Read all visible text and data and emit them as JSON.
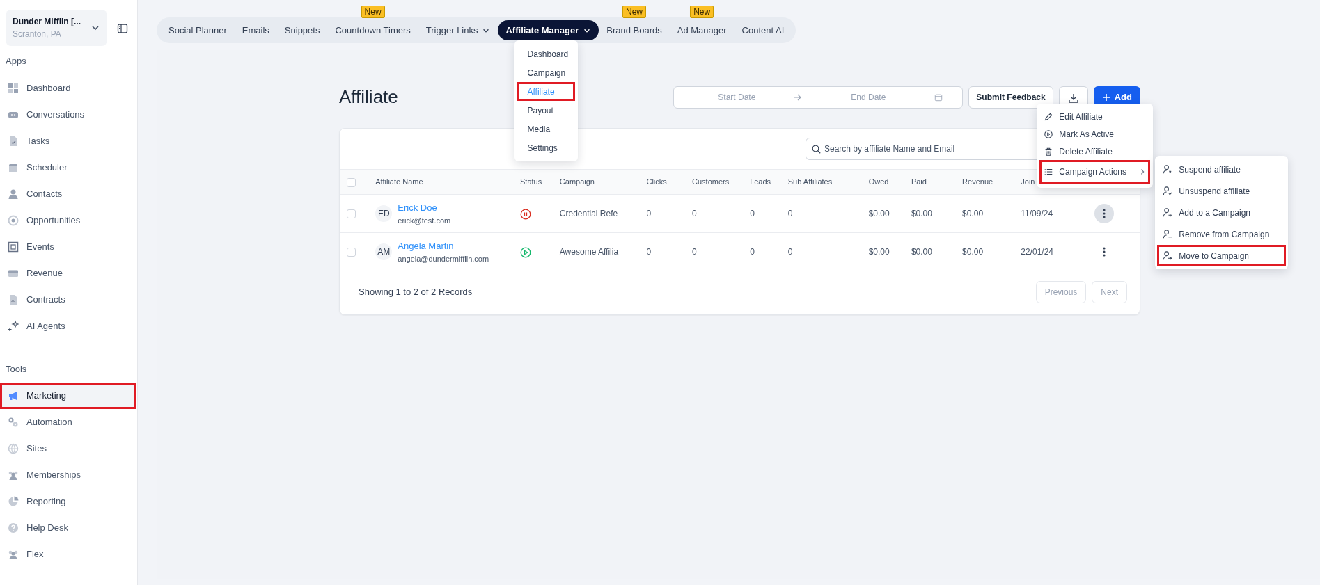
{
  "account": {
    "name": "Dunder Mifflin [...",
    "location": "Scranton, PA"
  },
  "sidebar": {
    "sections": [
      {
        "title": "Apps",
        "items": [
          {
            "label": "Dashboard",
            "selected": false,
            "highlighted": false
          },
          {
            "label": "Conversations",
            "selected": false,
            "highlighted": false
          },
          {
            "label": "Tasks",
            "selected": false,
            "highlighted": false
          },
          {
            "label": "Scheduler",
            "selected": false,
            "highlighted": false
          },
          {
            "label": "Contacts",
            "selected": false,
            "highlighted": false
          },
          {
            "label": "Opportunities",
            "selected": false,
            "highlighted": false
          },
          {
            "label": "Events",
            "selected": false,
            "highlighted": false
          },
          {
            "label": "Revenue",
            "selected": false,
            "highlighted": false
          },
          {
            "label": "Contracts",
            "selected": false,
            "highlighted": false
          },
          {
            "label": "AI Agents",
            "selected": false,
            "highlighted": false
          }
        ]
      },
      {
        "title": "Tools",
        "items": [
          {
            "label": "Marketing",
            "selected": true,
            "highlighted": true
          },
          {
            "label": "Automation",
            "selected": false,
            "highlighted": false
          },
          {
            "label": "Sites",
            "selected": false,
            "highlighted": false
          },
          {
            "label": "Memberships",
            "selected": false,
            "highlighted": false
          },
          {
            "label": "Reporting",
            "selected": false,
            "highlighted": false
          },
          {
            "label": "Help Desk",
            "selected": false,
            "highlighted": false
          },
          {
            "label": "Flex",
            "selected": false,
            "highlighted": false
          }
        ]
      }
    ]
  },
  "top_nav": [
    {
      "label": "Social Planner",
      "selected": false,
      "dropdown": false
    },
    {
      "label": "Emails",
      "selected": false,
      "dropdown": false
    },
    {
      "label": "Snippets",
      "selected": false,
      "dropdown": false
    },
    {
      "label": "Countdown Timers",
      "selected": false,
      "dropdown": false,
      "badge": "New"
    },
    {
      "label": "Trigger Links",
      "selected": false,
      "dropdown": true
    },
    {
      "label": "Affiliate Manager",
      "selected": true,
      "dropdown": true
    },
    {
      "label": "Brand Boards",
      "selected": false,
      "dropdown": false,
      "badge": "New"
    },
    {
      "label": "Ad Manager",
      "selected": false,
      "dropdown": false,
      "badge": "New"
    },
    {
      "label": "Content AI",
      "selected": false,
      "dropdown": false
    }
  ],
  "nav_dropdown": [
    {
      "label": "Dashboard",
      "selected": false,
      "highlighted": false
    },
    {
      "label": "Campaign",
      "selected": false,
      "highlighted": false
    },
    {
      "label": "Affiliate",
      "selected": true,
      "highlighted": true
    },
    {
      "label": "Payout",
      "selected": false,
      "highlighted": false
    },
    {
      "label": "Media",
      "selected": false,
      "highlighted": false
    },
    {
      "label": "Settings",
      "selected": false,
      "highlighted": false
    }
  ],
  "page": {
    "title": "Affiliate",
    "start_date": {
      "placeholder": "Start Date"
    },
    "end_date": {
      "placeholder": "End Date"
    },
    "feedback_button": "Submit Feedback",
    "add_button": "Add"
  },
  "table": {
    "search": {
      "placeholder": "Search by affiliate Name and Email"
    },
    "select_all_checked": false,
    "columns": [
      "Affiliate Name",
      "Status",
      "Campaign",
      "Clicks",
      "Customers",
      "Leads",
      "Sub Affiliates",
      "Owed",
      "Paid",
      "Revenue",
      "Join"
    ],
    "rows": [
      {
        "initials": "ED",
        "name": "Erick Doe",
        "email": "erick@test.com",
        "checked": false,
        "active": false,
        "campaign": "Credential Refe",
        "clicks": "0",
        "customers": "0",
        "leads": "0",
        "sub_affiliates": "0",
        "owed": "$0.00",
        "paid": "$0.00",
        "revenue": "$0.00",
        "joined": "11/09/24",
        "menu_open": true
      },
      {
        "initials": "AM",
        "name": "Angela Martin",
        "email": "angela@dundermifflin.com",
        "checked": false,
        "active": true,
        "campaign": "Awesome Affilia",
        "clicks": "0",
        "customers": "0",
        "leads": "0",
        "sub_affiliates": "0",
        "owed": "$0.00",
        "paid": "$0.00",
        "revenue": "$0.00",
        "joined": "22/01/24",
        "menu_open": false
      }
    ],
    "summary": "Showing 1 to 2 of 2 Records",
    "pagination": [
      {
        "label": "Previous",
        "disabled": true
      },
      {
        "label": "Next",
        "disabled": true
      }
    ]
  },
  "row_menu": [
    {
      "label": "Edit Affiliate",
      "submenu": false,
      "highlighted": false
    },
    {
      "label": "Mark As Active",
      "submenu": false,
      "highlighted": false
    },
    {
      "label": "Delete Affiliate",
      "submenu": false,
      "highlighted": false
    },
    {
      "label": "Campaign Actions",
      "submenu": true,
      "highlighted": true
    }
  ],
  "submenu": [
    {
      "label": "Suspend affiliate",
      "highlighted": false
    },
    {
      "label": "Unsuspend affiliate",
      "highlighted": false
    },
    {
      "label": "Add to a Campaign",
      "highlighted": false
    },
    {
      "label": "Remove from Campaign",
      "highlighted": false
    },
    {
      "label": "Move to Campaign",
      "highlighted": true
    }
  ]
}
